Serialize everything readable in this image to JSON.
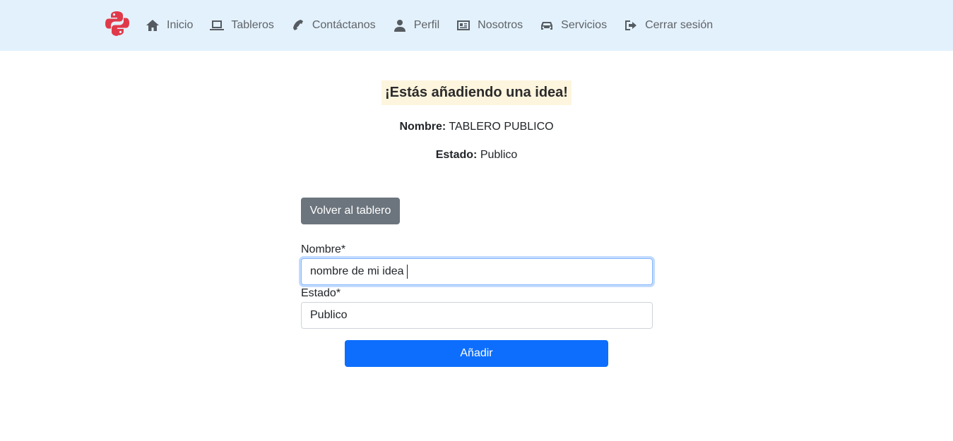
{
  "nav": {
    "logo_icon": "python-logo-icon",
    "items": [
      {
        "label": "Inicio",
        "icon": "home-icon"
      },
      {
        "label": "Tableros",
        "icon": "laptop-icon"
      },
      {
        "label": "Contáctanos",
        "icon": "phone-icon"
      },
      {
        "label": "Perfil",
        "icon": "user-icon"
      },
      {
        "label": "Nosotros",
        "icon": "id-card-icon"
      },
      {
        "label": "Servicios",
        "icon": "car-icon"
      },
      {
        "label": "Cerrar sesión",
        "icon": "sign-out-icon"
      }
    ]
  },
  "page": {
    "title": "¡Estás añadiendo una idea!",
    "board_name_label": "Nombre:",
    "board_name_value": "TABLERO PUBLICO",
    "board_state_label": "Estado:",
    "board_state_value": "Publico"
  },
  "form": {
    "back_button": "Volver al tablero",
    "name_label": "Nombre*",
    "name_value": "nombre de mi idea",
    "state_label": "Estado*",
    "state_value": "Publico",
    "submit_button": "Añadir"
  },
  "colors": {
    "navbar_bg": "#e3f1fc",
    "title_bg": "#fdf5de",
    "back_button": "#6c757d",
    "submit_button": "#0d6efd",
    "logo": "#e03a4a"
  }
}
